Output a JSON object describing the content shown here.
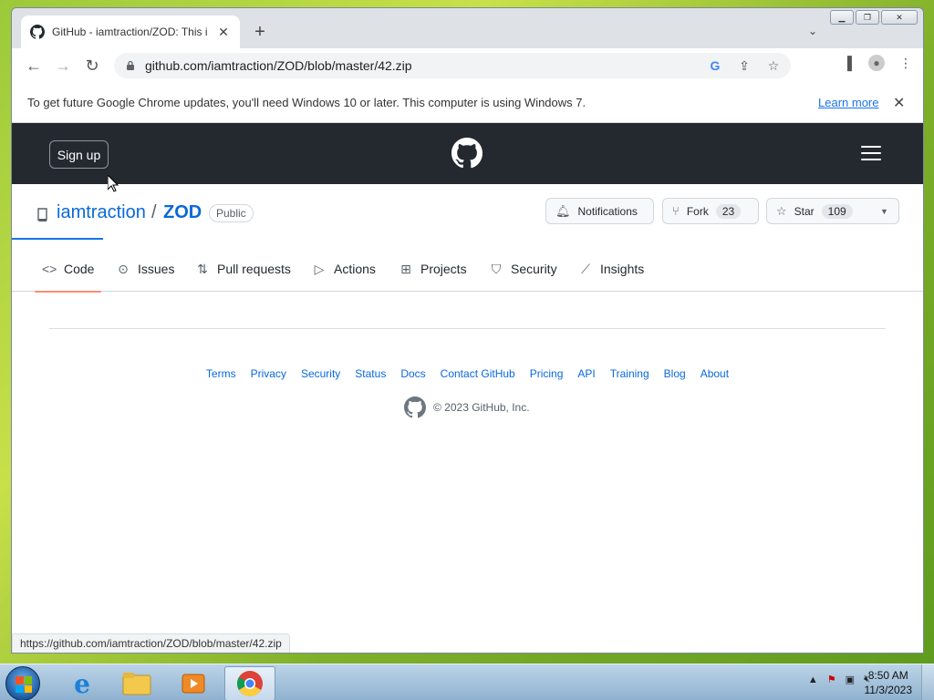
{
  "browser": {
    "tab_title": "GitHub - iamtraction/ZOD: This i",
    "url": "github.com/iamtraction/ZOD/blob/master/42.zip",
    "infobar_message": "To get future Google Chrome updates, you'll need Windows 10 or later. This computer is using Windows 7.",
    "infobar_link": "Learn more",
    "status_url": "https://github.com/iamtraction/ZOD/blob/master/42.zip"
  },
  "github": {
    "signup_label": "Sign up",
    "repo_owner": "iamtraction",
    "repo_separator": "/",
    "repo_name": "ZOD",
    "visibility": "Public",
    "notifications_label": "Notifications",
    "fork_label": "Fork",
    "fork_count": "23",
    "star_label": "Star",
    "star_count": "109",
    "nav": [
      {
        "label": "Code",
        "icon": "code-icon",
        "active": true
      },
      {
        "label": "Issues",
        "icon": "issue-icon"
      },
      {
        "label": "Pull requests",
        "icon": "pull-request-icon"
      },
      {
        "label": "Actions",
        "icon": "play-icon"
      },
      {
        "label": "Projects",
        "icon": "table-icon"
      },
      {
        "label": "Security",
        "icon": "shield-icon"
      },
      {
        "label": "Insights",
        "icon": "graph-icon"
      }
    ],
    "footer_links": [
      "Terms",
      "Privacy",
      "Security",
      "Status",
      "Docs",
      "Contact GitHub",
      "Pricing",
      "API",
      "Training",
      "Blog",
      "About"
    ],
    "copyright": "© 2023 GitHub, Inc."
  },
  "taskbar": {
    "time": "8:50 AM",
    "date": "11/3/2023"
  },
  "colors": {
    "header_bg": "#24292f",
    "link": "#0969da",
    "active_tab_underline": "#fd8c73"
  }
}
